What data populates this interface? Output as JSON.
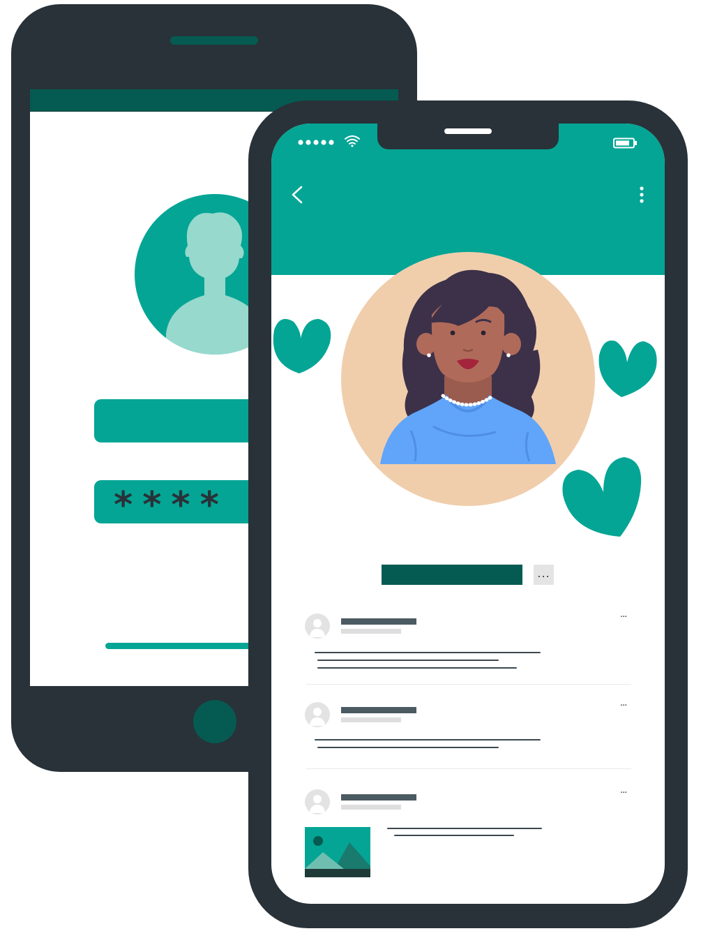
{
  "login_screen": {
    "password_mask": "****"
  },
  "profile_screen": {
    "name_more_label": "...",
    "posts": [
      {
        "more_label": "..."
      },
      {
        "more_label": "..."
      },
      {
        "more_label": "..."
      }
    ]
  },
  "colors": {
    "phone_frame": "#283238",
    "teal": "#04a595",
    "dark_teal": "#055b52",
    "light_teal": "#97d9cd",
    "avatar_bg": "#f0ceac",
    "shirt_blue": "#60a5f9"
  },
  "icons": {
    "signal": "signal-dots-icon",
    "wifi": "wifi-icon",
    "battery": "battery-icon",
    "back": "chevron-left-icon",
    "more": "vertical-dots-icon",
    "heart": "heart-icon",
    "user": "user-silhouette-icon",
    "image": "image-placeholder-icon"
  }
}
